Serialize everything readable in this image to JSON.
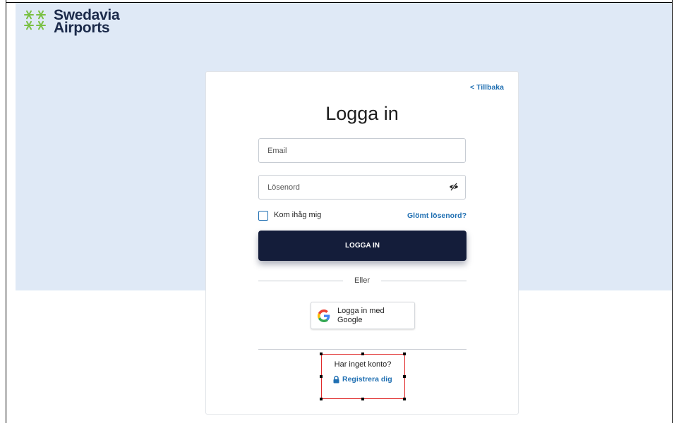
{
  "brand": {
    "name_line1": "Swedavia",
    "name_line2": "Airports",
    "logo_icon": "snowflake-cluster-logo",
    "logo_color": "#7ac043",
    "text_color": "#1b2a4a"
  },
  "colors": {
    "hero_background": "#dfe9f6",
    "primary_button": "#141d3a",
    "link": "#1f6fb2",
    "highlight": "#e02b2b"
  },
  "login_form": {
    "back_link": "< Tillbaka",
    "title": "Logga in",
    "email_placeholder": "Email",
    "password_placeholder": "Lösenord",
    "password_toggle_icon": "eye-slash-icon",
    "remember_me_label": "Kom ihåg mig",
    "remember_me_checked": false,
    "forgot_password_link": "Glömt lösenord?",
    "submit_label": "LOGGA IN",
    "or_separator": "Eller",
    "google_button_label": "Logga in med Google",
    "google_icon": "google-g-icon",
    "no_account_text": "Har inget konto?",
    "register_link": "Registrera dig",
    "register_icon": "lock-icon"
  }
}
